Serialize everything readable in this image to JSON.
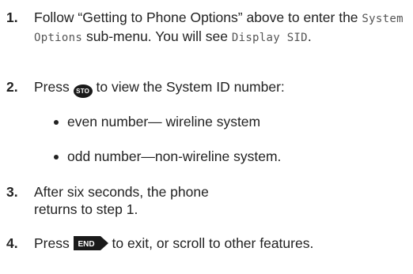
{
  "steps": [
    {
      "number": "1.",
      "text_a": "Follow “Getting to Phone Options” above to enter the",
      "lcd_a": "System Options",
      "text_b": "sub-menu. You will see",
      "lcd_b": "Display SID",
      "text_c": "."
    },
    {
      "number": "2.",
      "text_a": "Press",
      "key_icon": "sto-key-icon",
      "key_label": "STO",
      "text_b": "to view the System ID number:",
      "bullets": [
        "even number— wireline system",
        "odd number—non-wireline system."
      ]
    },
    {
      "number": "3.",
      "text": "After six seconds, the phone returns to step 1."
    },
    {
      "number": "4.",
      "text_a": "Press",
      "key_icon": "end-key-icon",
      "key_label": "END",
      "text_b": "to exit, or scroll to other features."
    }
  ]
}
